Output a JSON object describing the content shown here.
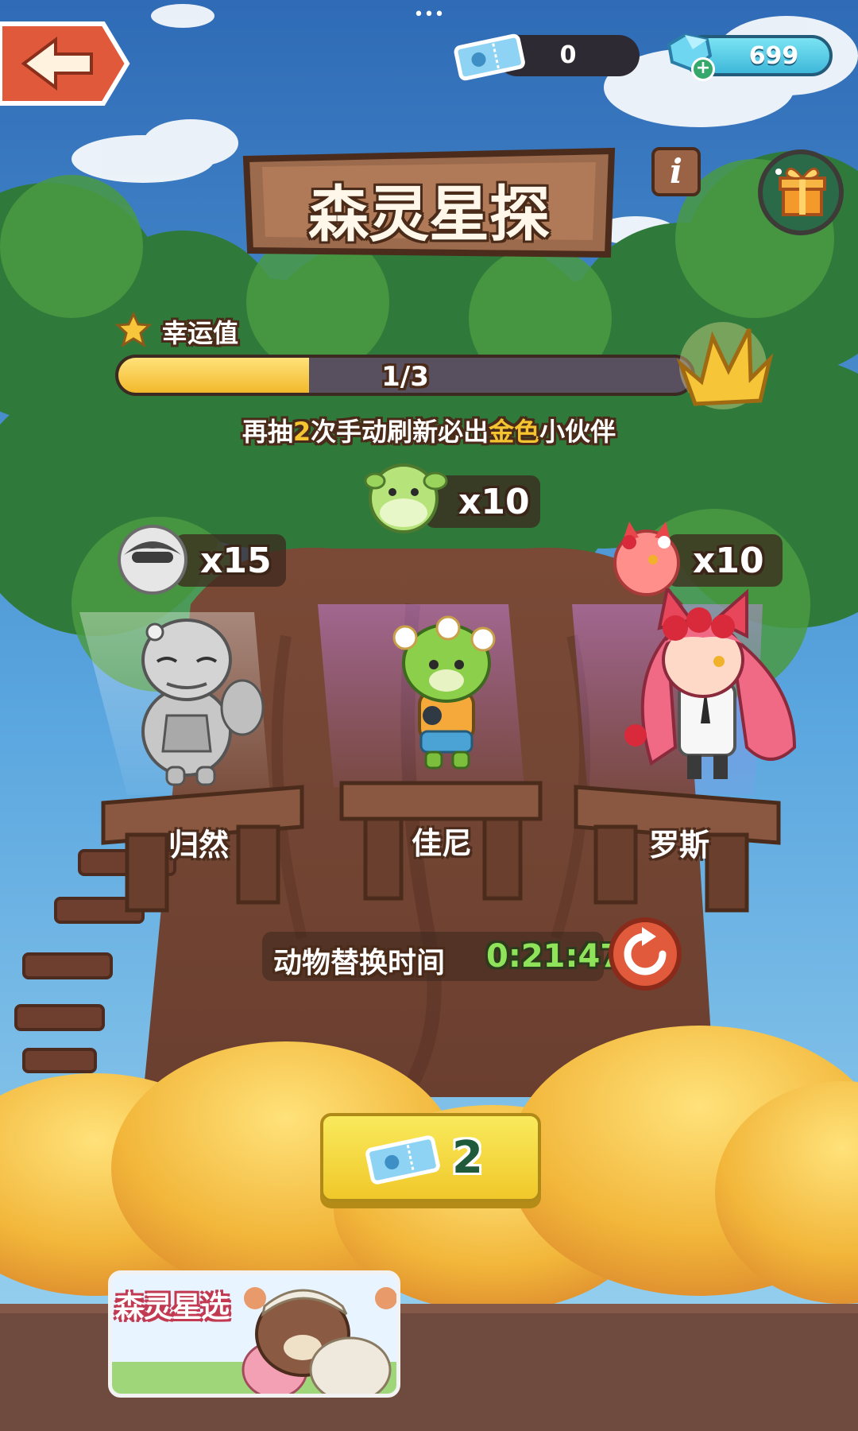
{
  "status_bar": {
    "dots": "•••"
  },
  "currency": {
    "tickets": "0",
    "gems": "699"
  },
  "title": "森灵星探",
  "luck": {
    "label": "幸运值",
    "progress_text": "1/3",
    "progress": 0.333,
    "hint_parts": [
      "再抽",
      "2",
      "次手动刷新必出",
      "金色",
      "小伙伴"
    ]
  },
  "partners": [
    {
      "name": "归然",
      "count": "x15"
    },
    {
      "name": "佳尼",
      "count": "x10"
    },
    {
      "name": "罗斯",
      "count": "x10"
    }
  ],
  "refresh": {
    "label": "动物替换时间",
    "timer": "0:21:47"
  },
  "draw_button": {
    "cost": "2"
  },
  "banner": {
    "label": "森灵星选"
  },
  "icons": {
    "back": "back-arrow-icon",
    "ticket": "ticket-icon",
    "gem": "gem-icon",
    "add": "plus-icon",
    "info": "info-icon",
    "gift": "gift-box-icon",
    "star": "star-icon",
    "crown": "crown-icon",
    "refresh": "refresh-icon"
  },
  "colors": {
    "progress_fill": "#f6c744",
    "highlight_gold": "#f5c531",
    "timer_green": "#8ee35a",
    "draw_button": "#f3dc3c",
    "refresh_button": "#e05a3b"
  }
}
